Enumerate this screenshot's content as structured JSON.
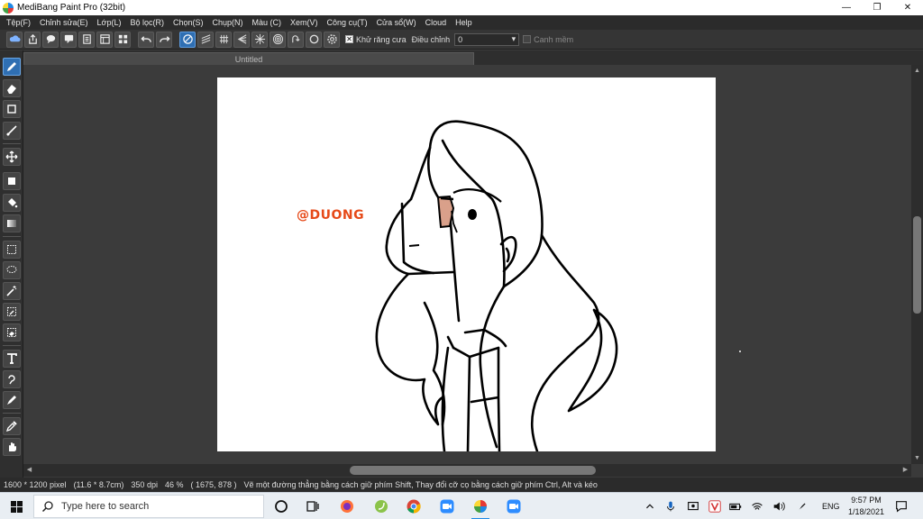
{
  "window": {
    "title": "MediBang Paint Pro (32bit)",
    "minimize": "—",
    "maximize": "❐",
    "close": "✕"
  },
  "menu": [
    "Tệp(F)",
    "Chỉnh sửa(E)",
    "Lớp(L)",
    "Bộ lọc(R)",
    "Chọn(S)",
    "Chụp(N)",
    "Màu (C)",
    "Xem(V)",
    "Công cụ(T)",
    "Cửa sổ(W)",
    "Cloud",
    "Help"
  ],
  "toolbar": {
    "antialias_label": "Khử răng cưa",
    "antialias_check": "✕",
    "adjust_label": "Điều chỉnh",
    "adjust_value": "0",
    "adjust_arrow": "▾",
    "edge_label": "Canh mềm"
  },
  "tab": {
    "name": "Untitled"
  },
  "canvas": {
    "watermark": "@DUONG"
  },
  "colors": {
    "skin": "#d9a08a",
    "line": "#000000",
    "watermark": "#e64a19",
    "accent": "#2f6fb3"
  },
  "scroll": {
    "up": "▲",
    "down": "▼",
    "left": "◀",
    "right": "▶"
  },
  "status": {
    "size": "1600 * 1200 pixel",
    "cm": "(11.6 * 8.7cm)",
    "dpi": "350 dpi",
    "zoom": "46 %",
    "coords": "( 1675, 878 )",
    "hint": "Vẽ một đường thẳng bằng cách giữ phím Shift, Thay đổi cỡ cọ bằng cách giữ phím Ctrl, Alt và kéo"
  },
  "taskbar": {
    "search_placeholder": "Type here to search",
    "lang": "ENG",
    "time": "9:57 PM",
    "date": "1/18/2021"
  }
}
